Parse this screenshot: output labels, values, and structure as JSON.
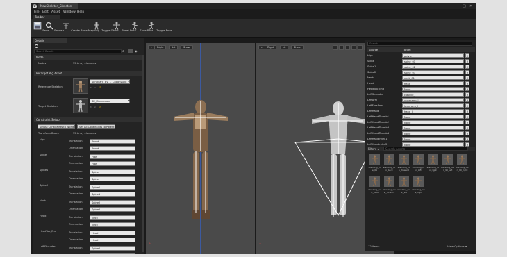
{
  "window": {
    "doc_tab": "NewSkeleton_Skeleton",
    "controls": [
      "–",
      "□",
      "✕"
    ]
  },
  "menu": [
    "File",
    "Edit",
    "Asset",
    "Window",
    "Help"
  ],
  "toolbar": {
    "tab_label": "Toolbar",
    "buttons": [
      {
        "label": "Save",
        "icon": "save-icon"
      },
      {
        "label": "Browse",
        "icon": "browse-icon"
      },
      {
        "label": "Create Bone Mapping",
        "icon": "create-bone-mapping-icon"
      },
      {
        "label": "Toggle Ghost",
        "icon": "toggle-ghost-icon"
      },
      {
        "label": "Reset Pose",
        "icon": "reset-pose-icon"
      },
      {
        "label": "Save Pose",
        "icon": "save-pose-icon"
      },
      {
        "label": "Toggle Pose",
        "icon": "toggle-pose-icon"
      }
    ]
  },
  "details": {
    "tab_label": "Details",
    "search_placeholder": "Search Details",
    "node_section": "Node",
    "nodes_label": "Nodes",
    "nodes_value": "55 Array elements",
    "retarget_section": "Retarget Rig Asset",
    "reference_skeleton_label": "Reference Skeleton",
    "reference_skeleton_value": "Vanguard_By_T._Choonyung",
    "target_skeleton_label": "Target Skeleton",
    "target_skeleton_value": "SK_Mannequin",
    "constraint_section": "Constraint Setup",
    "set_all_world": "Set All Constraints to World",
    "set_all_parent": "Set All Constraints to Parent",
    "transform_bases_label": "Transform Bases",
    "transform_bases_value": "55 Array elements",
    "translation_label": "Translation",
    "orientation_label": "Orientation",
    "bones": [
      {
        "name": "Hips",
        "translation": "World",
        "orientation": "World"
      },
      {
        "name": "Spine",
        "translation": "Hips",
        "orientation": "Hips"
      },
      {
        "name": "Spine1",
        "translation": "Spine",
        "orientation": "Spine"
      },
      {
        "name": "Spine2",
        "translation": "Spine1",
        "orientation": "Spine1"
      },
      {
        "name": "Neck",
        "translation": "Spine2",
        "orientation": "Spine2"
      },
      {
        "name": "Head",
        "translation": "Neck",
        "orientation": "Neck"
      },
      {
        "name": "HeadTop_End",
        "translation": "Head",
        "orientation": "Head"
      },
      {
        "name": "LeftShoulder",
        "translation": "Spine2",
        "orientation": ""
      }
    ]
  },
  "viewport_left": {
    "buttons": [
      "▾",
      "Right",
      "Lit",
      "Show"
    ]
  },
  "viewport_right": {
    "buttons": [
      "▾",
      "Right",
      "Lit",
      "Show"
    ]
  },
  "mapping": {
    "search_placeholder": "Search",
    "col_source": "Source",
    "col_target": "Target",
    "rows": [
      {
        "source": "Hips",
        "target": "pelvis"
      },
      {
        "source": "Spine",
        "target": "spine_01"
      },
      {
        "source": "Spine1",
        "target": "spine_02"
      },
      {
        "source": "Spine2",
        "target": "spine_03"
      },
      {
        "source": "Neck",
        "target": "neck_01"
      },
      {
        "source": "Head",
        "target": "head"
      },
      {
        "source": "HeadTop_End",
        "target": "None"
      },
      {
        "source": "LeftShoulder",
        "target": "clavicle_l"
      },
      {
        "source": "LeftArm",
        "target": "upperarm_l"
      },
      {
        "source": "LeftForeArm",
        "target": "lowerarm_l"
      },
      {
        "source": "LeftHand",
        "target": "hand_l"
      },
      {
        "source": "LeftHandThumb1",
        "target": "None"
      },
      {
        "source": "LeftHandThumb2",
        "target": "None"
      },
      {
        "source": "LeftHandThumb3",
        "target": "None"
      },
      {
        "source": "LeftHandThumb4",
        "target": "None"
      },
      {
        "source": "LeftHandIndex1",
        "target": "None"
      },
      {
        "source": "LeftHandIndex2",
        "target": "None"
      }
    ]
  },
  "anims": {
    "filters_label": "Filters ▾",
    "search_placeholder": "Search Assets",
    "items": [
      "standing_idle_01",
      "standing_run_back",
      "standing_run_forward",
      "standing_run_left",
      "standing_run_right",
      "standing_turn_90_left",
      "standing_turn_90_right",
      "standing_walk_back",
      "standing_walk_forward",
      "standing_walk_left",
      "standing_walk_right"
    ],
    "count": "12 items",
    "view_options": "View Options ▾"
  },
  "colors": {
    "accent": "#3a6fbf",
    "panel": "#242424",
    "viewport": "#4a4a4a"
  }
}
